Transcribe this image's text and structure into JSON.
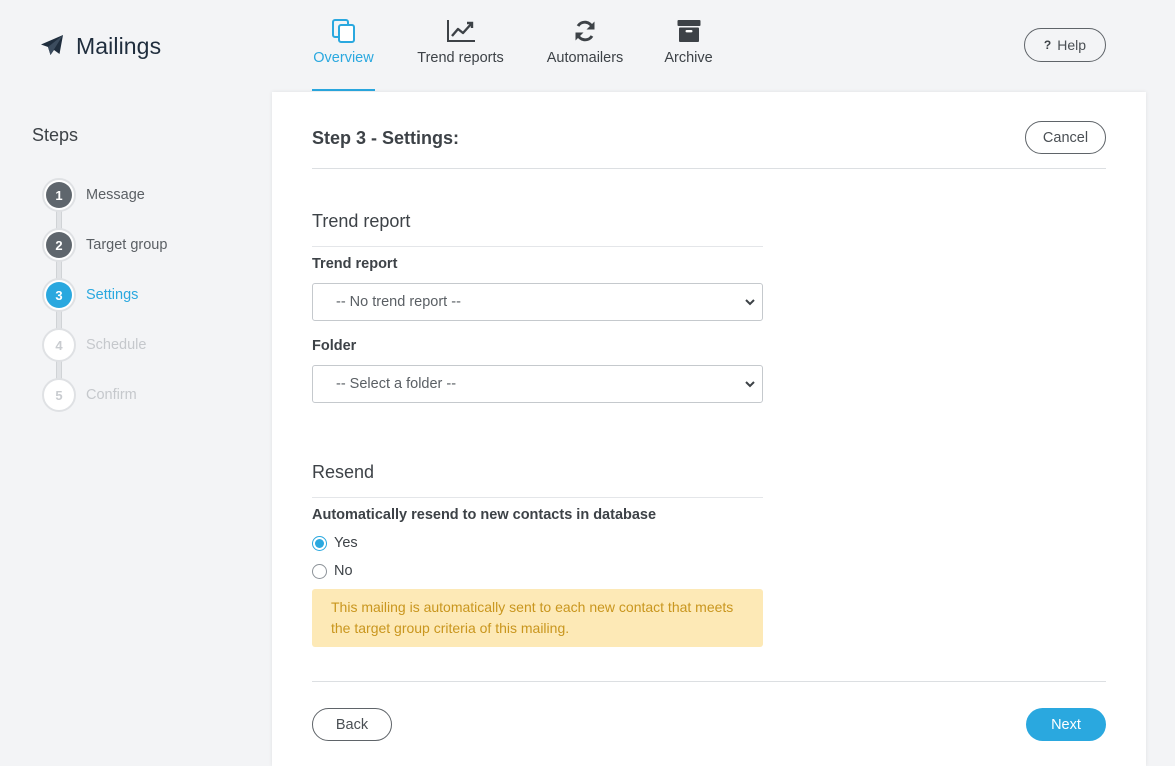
{
  "app": {
    "title": "Mailings",
    "logo_icon": "paper-plane-icon"
  },
  "nav": {
    "tabs": [
      {
        "label": "Overview",
        "icon": "copy-icon",
        "active": true
      },
      {
        "label": "Trend reports",
        "icon": "line-chart-icon",
        "active": false
      },
      {
        "label": "Automailers",
        "icon": "refresh-icon",
        "active": false
      },
      {
        "label": "Archive",
        "icon": "archive-icon",
        "active": false
      }
    ],
    "help_label": "Help",
    "help_glyph": "?"
  },
  "sidebar": {
    "title": "Steps",
    "steps": [
      {
        "number": "1",
        "label": "Message",
        "state": "done"
      },
      {
        "number": "2",
        "label": "Target group",
        "state": "done"
      },
      {
        "number": "3",
        "label": "Settings",
        "state": "current"
      },
      {
        "number": "4",
        "label": "Schedule",
        "state": "todo"
      },
      {
        "number": "5",
        "label": "Confirm",
        "state": "todo"
      }
    ]
  },
  "main": {
    "title": "Step 3 - Settings:",
    "cancel_label": "Cancel",
    "trend_section": {
      "title": "Trend report",
      "trend_field_label": "Trend report",
      "trend_selected": "-- No trend report --",
      "folder_field_label": "Folder",
      "folder_selected": "-- Select a folder --"
    },
    "resend_section": {
      "title": "Resend",
      "question": "Automatically resend to new contacts in database",
      "options": [
        {
          "label": "Yes",
          "checked": true
        },
        {
          "label": "No",
          "checked": false
        }
      ],
      "notice": "This mailing is automatically sent to each new contact that meets the target group criteria of this mailing."
    },
    "back_label": "Back",
    "next_label": "Next"
  },
  "colors": {
    "accent": "#2aa8df",
    "notice_bg": "#fde9b6",
    "notice_text": "#c9961e",
    "step_done": "#5f666d"
  }
}
